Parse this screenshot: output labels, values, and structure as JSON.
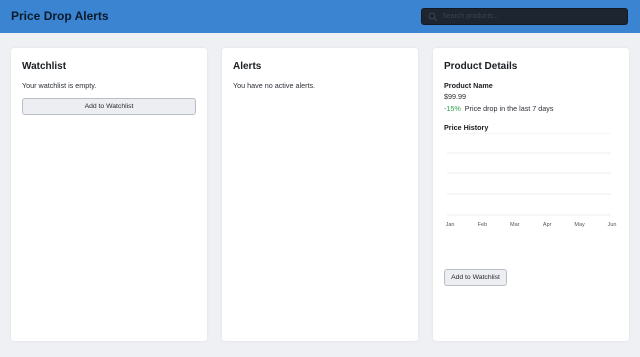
{
  "header": {
    "title": "Price Drop Alerts",
    "search_placeholder": "Search products..."
  },
  "watchlist": {
    "title": "Watchlist",
    "empty_text": "Your watchlist is empty.",
    "add_button": "Add to Watchlist"
  },
  "alerts": {
    "title": "Alerts",
    "empty_text": "You have no active alerts."
  },
  "product": {
    "title": "Product Details",
    "name": "Product Name",
    "price": "$99.99",
    "drop_percent": "-15%",
    "drop_text": "Price drop in the last 7 days",
    "history_title": "Price History",
    "add_button": "Add to Watchlist"
  },
  "chart_data": {
    "type": "line",
    "title": "Price History",
    "categories": [
      "Jan",
      "Feb",
      "Mar",
      "Apr",
      "May",
      "Jun"
    ],
    "series": [],
    "grid": true
  },
  "colors": {
    "header_bg": "#3a84d1",
    "discount_green": "#2e9e45"
  }
}
